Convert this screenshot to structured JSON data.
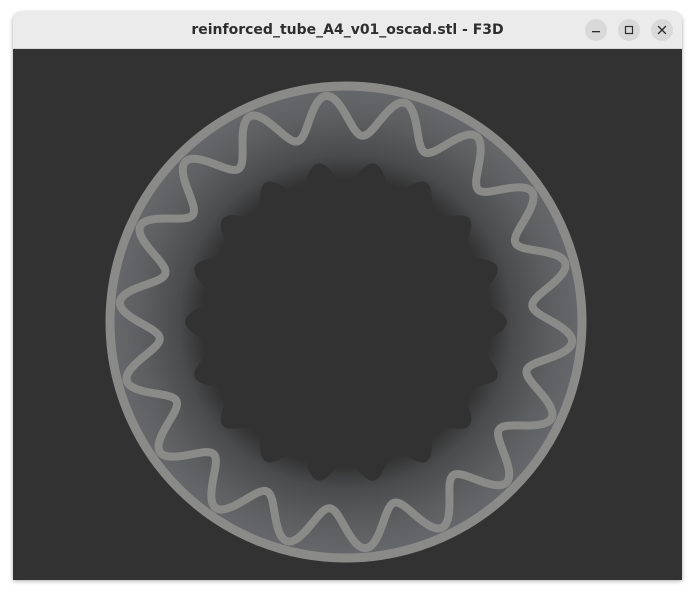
{
  "window": {
    "title": "reinforced_tube_A4_v01_oscad.stl - F3D"
  },
  "controls": {
    "minimize_icon": "minimize-icon",
    "maximize_icon": "maximize-icon",
    "close_icon": "close-icon"
  },
  "viewport": {
    "background_color": "#323232",
    "model_color": "#8a8a88",
    "inner_wall_color": "#5a5b5d",
    "inner_lobes": 18,
    "wave_count": 18
  }
}
